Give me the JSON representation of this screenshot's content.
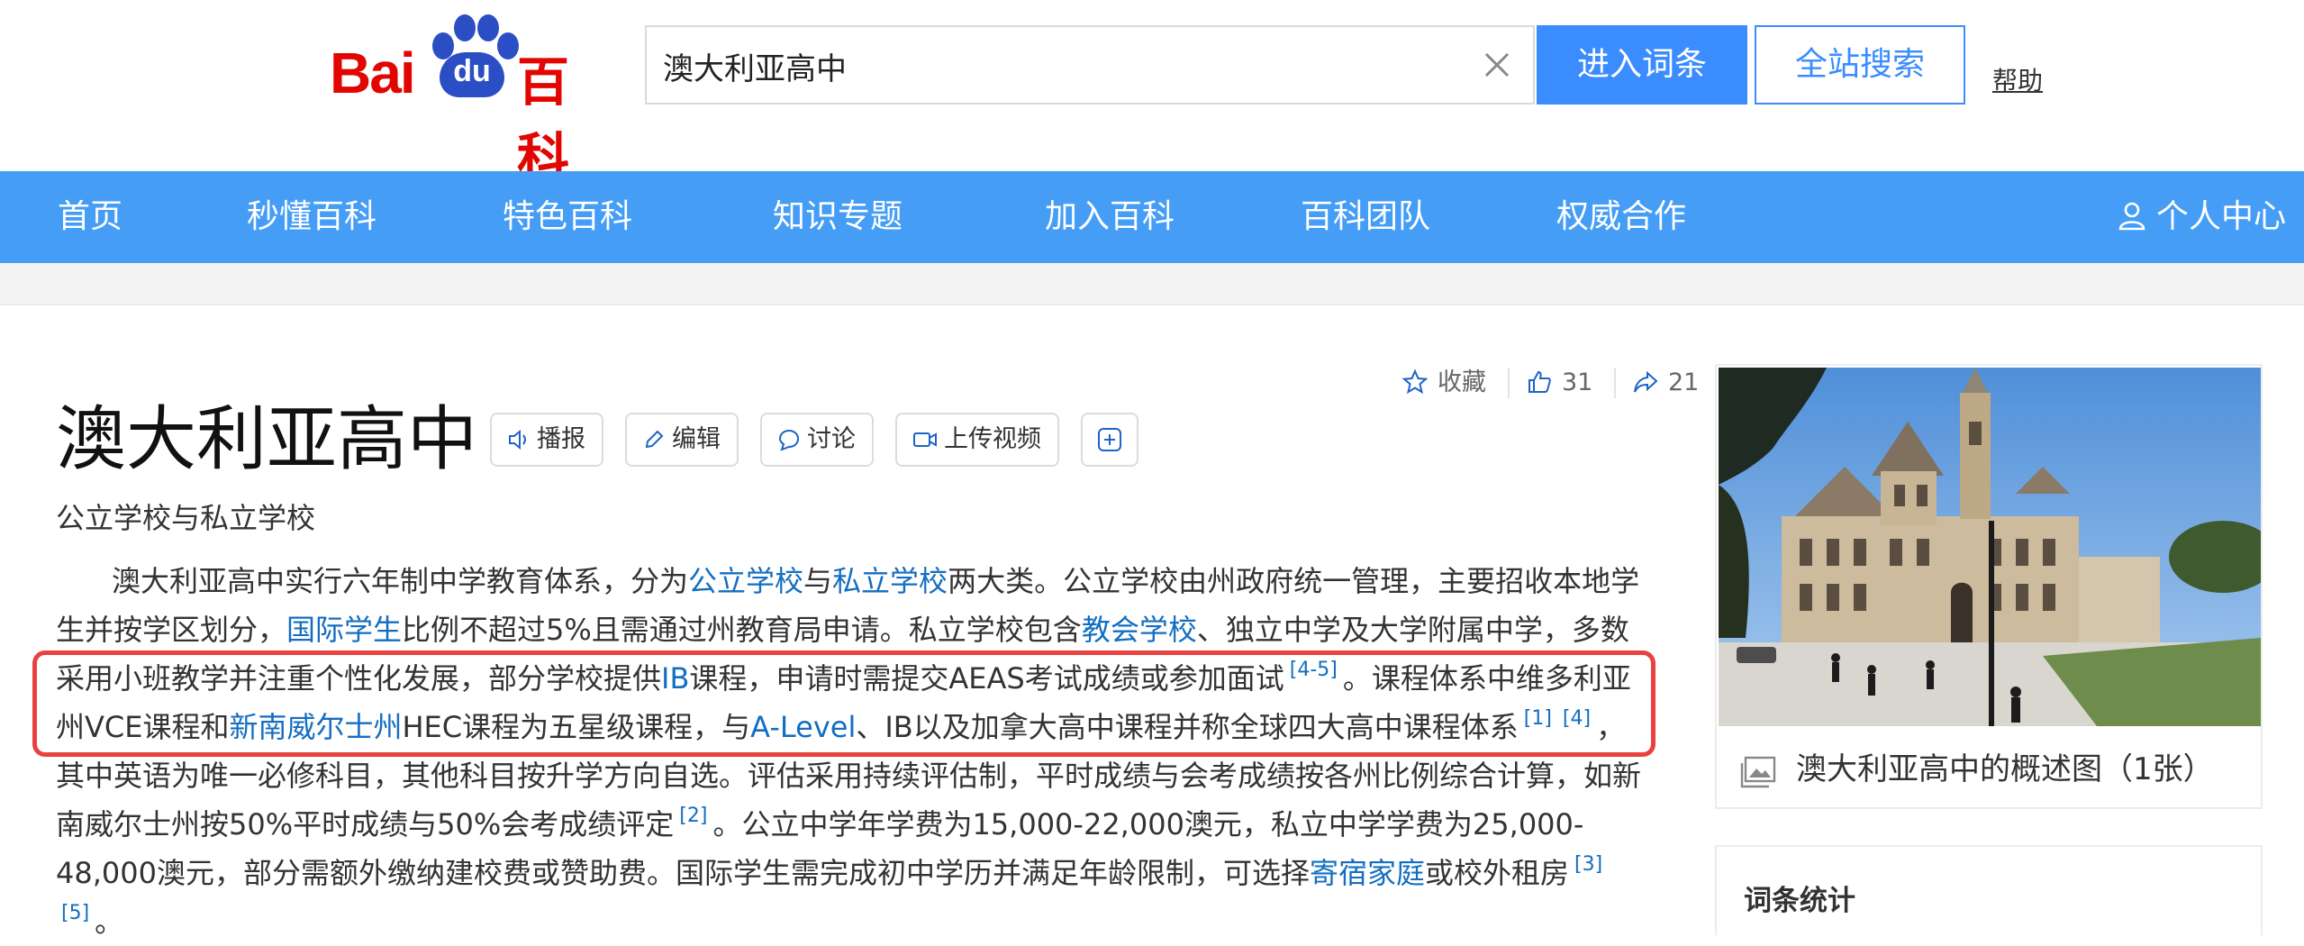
{
  "header": {
    "logo": {
      "bai": "Bai",
      "du": "du",
      "baike": "百科"
    },
    "search": {
      "value": "澳大利亚高中"
    },
    "enter_button": "进入词条",
    "site_search_button": "全站搜索",
    "help_link": "帮助"
  },
  "nav": {
    "items": [
      "首页",
      "秒懂百科",
      "特色百科",
      "知识专题",
      "加入百科",
      "百科团队",
      "权威合作"
    ],
    "user": "个人中心"
  },
  "article": {
    "title": "澳大利亚高中",
    "subtitle": "公立学校与私立学校",
    "tools": {
      "play": "播报",
      "edit": "编辑",
      "discuss": "讨论",
      "upload_video": "上传视频"
    },
    "actions": {
      "favorite": "收藏",
      "like_count": "31",
      "share_count": "21"
    },
    "summary": {
      "t1": "澳大利亚高中实行六年制中学教育体系，分为",
      "l1": "公立学校",
      "t2": "与",
      "l2": "私立学校",
      "t3": "两大类。公立学校由州政府统一管理，主要招收本地学生并按学区划分，",
      "l3": "国际学生",
      "t4": "比例不超过5%且需通过州教育局申请。私立学校包含",
      "l4": "教会学校",
      "t5": "、独立中学及大学附属中学，多数采用小班教学并注重个性化发展，部分学校提供",
      "l5": "IB",
      "t6": "课程，申请时需提交AEAS考试成绩或参加面试",
      "r1": "[4-5]",
      "t7": "。课程体系中维多利亚州VCE课程和",
      "l6": "新南威尔士州",
      "t8": "HEC课程为五星级课程，与",
      "l7": "A-Level",
      "t9": "、IB以及加拿大高中课程并称全球四大高中课程体系",
      "r2": "[1]",
      "r3": "[4]",
      "t10": "，其中英语为唯一必修科目，其他科目按升学方向自选。评估采用持续评估制，平时成绩与会考成绩按各州比例综合计算，如新南威尔士州按50%平时成绩与50%会考成绩评定",
      "r4": "[2]",
      "t11": "。公立中学年学费为15,000-22,000澳元，私立中学学费为25,000-48,000澳元，部分需额外缴纳建校费或赞助费。国际学生需完成初中学历并满足年龄限制，可选择",
      "l8": "寄宿家庭",
      "t12": "或校外租房",
      "r5": "[3]",
      "r6": "[5]",
      "t13": "。"
    }
  },
  "sidebar": {
    "image_caption": "澳大利亚高中的概述图（1张）",
    "stats_title": "词条统计"
  },
  "colors": {
    "nav_bg": "#459df5",
    "primary": "#3b8cff",
    "link": "#136ec2",
    "logo_red": "#e10601",
    "logo_blue": "#2b4ec4",
    "highlight": "#e8413e"
  }
}
